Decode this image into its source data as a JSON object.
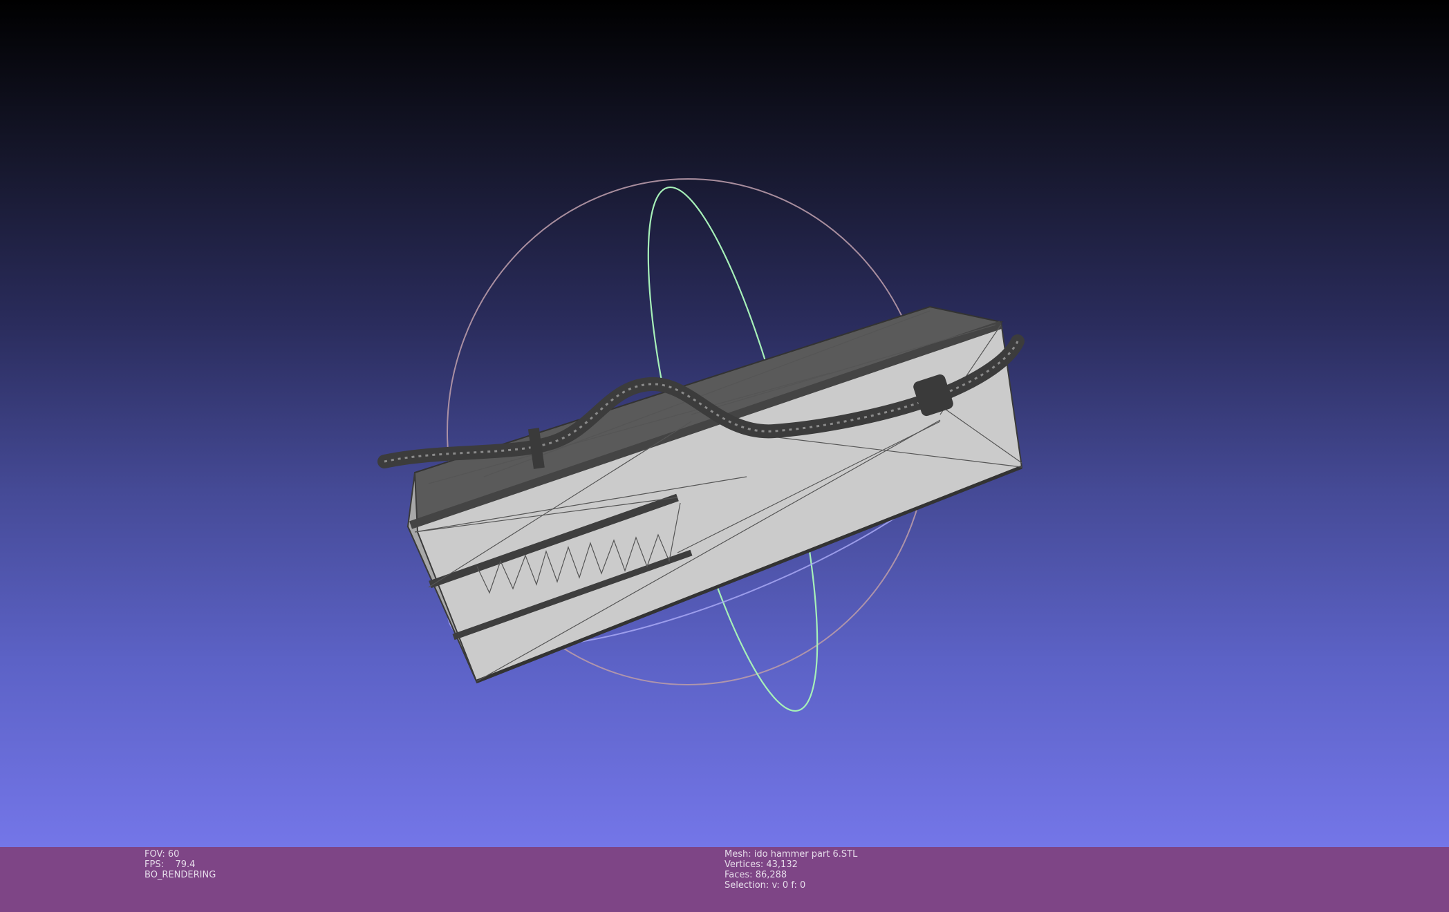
{
  "viewer": {
    "left_info": {
      "fov_label": "FOV:",
      "fov_value": "60",
      "fps_label": "FPS:",
      "fps_value": "79.4",
      "render_mode": "BO_RENDERING"
    },
    "mesh_info": {
      "mesh_label": "Mesh:",
      "mesh_name": "ido hammer part 6.STL",
      "vertices_label": "Vertices:",
      "vertices": "43,132",
      "faces_label": "Faces:",
      "faces": "86,288",
      "selection_label": "Selection:",
      "selection": "v: 0 f: 0"
    }
  },
  "colors": {
    "background_top": "#000000",
    "background_bottom": "#7476e8",
    "info_bar": "#7e4586",
    "mesh_face": "#c8c8c8",
    "mesh_edge": "#3a3a3a",
    "trackball_red": "#c8a0b0",
    "trackball_green": "#a0e8b0",
    "trackball_blue": "#a0a0f0"
  }
}
